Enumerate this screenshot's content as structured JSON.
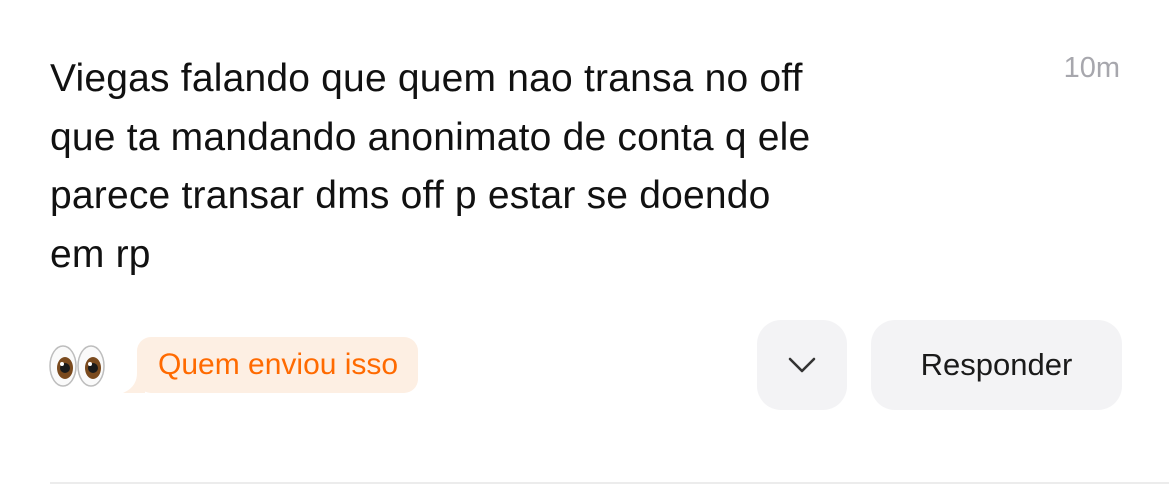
{
  "message": {
    "lines": [
      "Viegas falando que quem nao transa no off",
      "que ta mandando anonimato de conta q ele",
      "parece transar dms off p estar se doendo",
      "em rp"
    ],
    "timestamp": "10m"
  },
  "reaction": {
    "icon": "eyes-emoji-icon"
  },
  "actions": {
    "who_sent_label": "Quem enviou isso",
    "more_icon": "chevron-down-icon",
    "reply_label": "Responder"
  },
  "colors": {
    "accent": "#ff6a00",
    "accent_bg": "#fdefe3",
    "button_bg": "#f3f3f5",
    "muted_text": "#a7a7ad"
  }
}
